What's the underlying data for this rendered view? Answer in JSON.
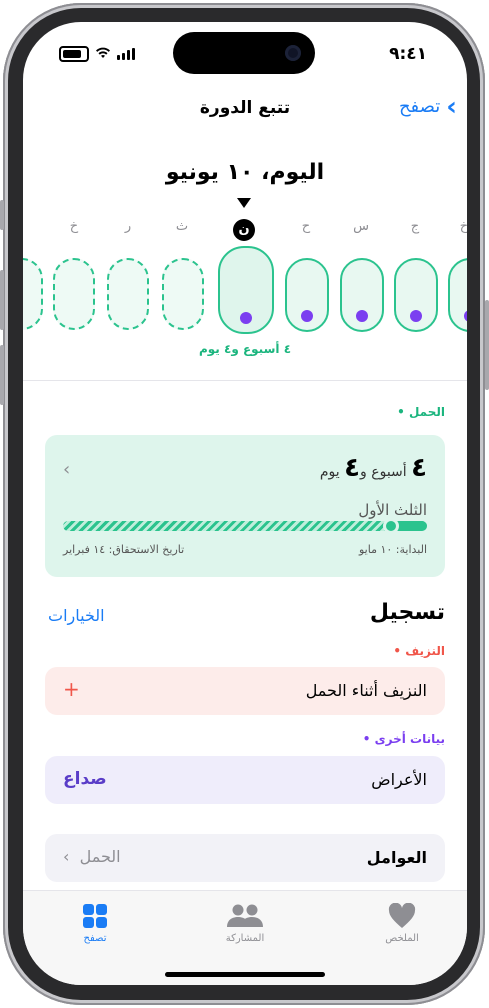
{
  "status": {
    "time": "٩:٤١"
  },
  "nav": {
    "title": "تتبع الدورة",
    "back_label": "تصفح"
  },
  "calendar": {
    "date_title": "اليوم، ١٠ يونيو",
    "day_letters": [
      "خ",
      "ر",
      "ث",
      "ن",
      "ح",
      "س",
      "ج",
      "خ"
    ],
    "gestation_label": "٤ أسبوع و٤ يوم"
  },
  "pregnancy": {
    "section_label": "الحمل",
    "weeks_number": "٤",
    "weeks_word": "أسبوع",
    "and": "و",
    "days_number": "٤",
    "days_word": "يوم",
    "trimester": "الثلث الأول",
    "start_label": "البداية: ١٠ مايو",
    "due_label": "تاريخ الاستحقاق: ١٤ فبراير",
    "progress": 0.1
  },
  "log": {
    "title": "تسجيل",
    "options_label": "الخيارات",
    "bleeding_section": "النزيف",
    "bleeding_row": "النزيف أثناء الحمل",
    "add_symbol": "+",
    "other_section": "بيانات أخرى",
    "symptoms_label": "الأعراض",
    "symptoms_value": "صداع",
    "factors_label": "العوامل",
    "factors_value": "الحمل"
  },
  "tabs": [
    {
      "label": "الملخص"
    },
    {
      "label": "المشاركة"
    },
    {
      "label": "تصفح"
    }
  ],
  "colors": {
    "accent_blue": "#1a7cf5",
    "mint": "#2bc38e",
    "purple": "#7b3ff0",
    "bleeding_red": "#f0564a"
  }
}
